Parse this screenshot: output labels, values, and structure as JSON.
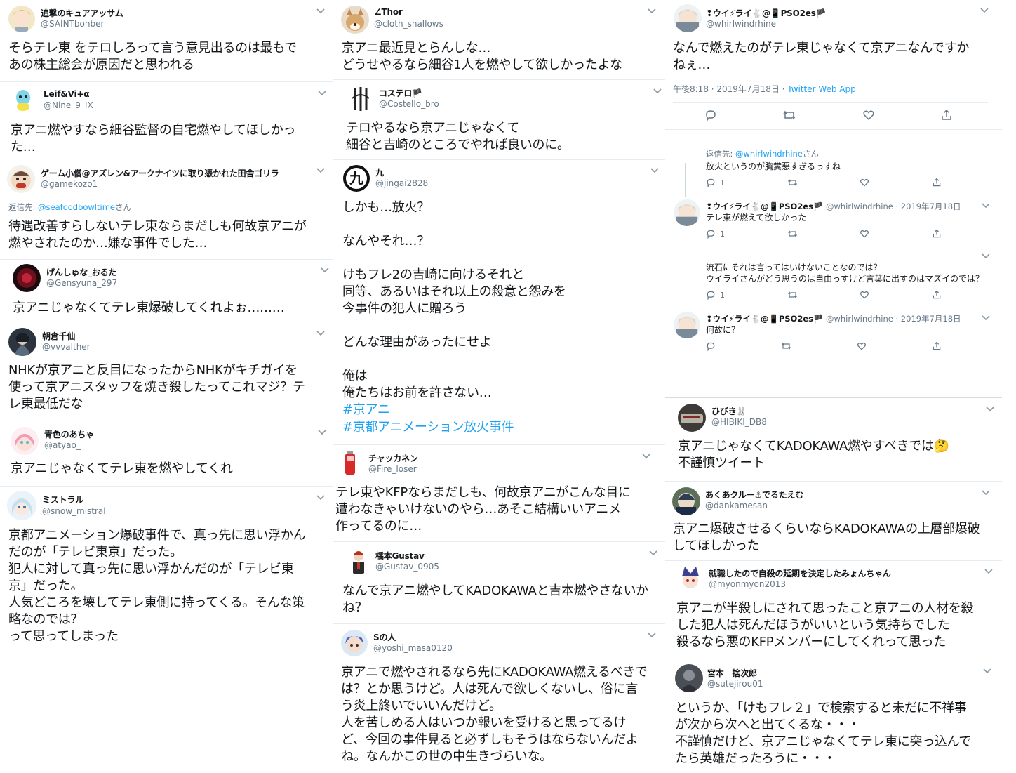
{
  "col1": [
    {
      "name": "追撃のキュアアッサム",
      "handle": "@SAINTbonber",
      "text": "そらテレ東 をテロしろって言う意見出るのは最もで\nあの株主総会が原因だと思われる"
    },
    {
      "name": "Leif&Vi+α",
      "handle": "@Nine_9_IX",
      "text": "京アニ燃やすなら細谷監督の自宅燃やしてほしかっ\nた…"
    },
    {
      "name": "ゲーム小僧@アズレン&アークナイツに取り憑かれた田舎ゴリラ",
      "handle": "@gamekozo1",
      "reply_prefix": "返信先: ",
      "reply_user": "@seafoodbowltime",
      "reply_suffix": "さん",
      "text": "待遇改善すらしないテレ東ならまだしも何故京アニが\n燃やされたのか…嫌な事件でした…"
    },
    {
      "name": "げんしゅな_おるた",
      "handle": "@Gensyuna_297",
      "text": "京アニじゃなくてテレ東爆破してくれよぉ………"
    },
    {
      "name": "朝倉千仙",
      "handle": "@vvvalther",
      "text": "NHKが京アニと反目になったからNHKがキチガイを\n使って京アニスタッフを焼き殺したってこれマジ？テ\nレ東最低だな"
    },
    {
      "name": "青色のあちゃ",
      "handle": "@atyao_",
      "text": "京アニじゃなくてテレ東を燃やしてくれ"
    },
    {
      "name": "ミストラル",
      "handle": "@snow_mistral",
      "text": "京都アニメーション爆破事件で、真っ先に思い浮かん\nだのが「テレビ東京」だった。\n犯人に対して真っ先に思い浮かんだのが「テレビ東\n京」だった。\n人気どころを壊してテレ東側に持ってくる。そんな策\n略なのでは？\nって思ってしまった"
    }
  ],
  "col2": [
    {
      "name": "∠Thor",
      "handle": "@cloth_shallows",
      "text": "京アニ最近見とらんしな…\nどうせやるなら細谷1人を燃やして欲しかったよな"
    },
    {
      "name": "コステロ🏴",
      "handle": "@Costello_bro",
      "text": "テロやるなら京アニじゃなくて\n細谷と吉崎のところでやれば良いのに。"
    },
    {
      "name": "九",
      "handle": "@jingai2828",
      "text": "しかも…放火？\n\nなんやそれ…？\n\nけもフレ2の吉崎に向けるそれと\n同等、あるいはそれ以上の殺意と怨みを\n今事件の犯人に贈ろう\n\nどんな理由があったにせよ\n\n俺は\n俺たちはお前を許さない…",
      "hashtags": [
        "#京アニ",
        "#京都アニメーション放火事件"
      ]
    },
    {
      "name": "チャッカネン",
      "handle": "@Fire_loser",
      "text": "テレ東やKFPならまだしも、何故京アニがこんな目に\n遭わなきゃいけないのやら…あそこ結構いいアニメ\n作ってるのに…"
    },
    {
      "name": "橋本Gustav",
      "handle": "@Gustav_0905",
      "text": "なんで京アニ燃やしてKADOKAWAと吉本燃やさないか\nね？"
    },
    {
      "name": "Sの人",
      "handle": "@yoshi_masa0120",
      "text": "京アニで燃やされるなら先にKADOKAWA燃えるべきで\nは？とか思うけど。人は死んで欲しくないし、俗に言\nう炎上終いでいいんだけど。\n人を苦しめる人はいつか報いを受けると思ってるけ\nど、今回の事件見ると必ずしもそうはならないんだよ\nね。なんかこの世の中生きづらいな。"
    }
  ],
  "col3_main": {
    "name": "❢ウイ⚡ライ🐇@📱PSO2es🏴",
    "handle": "@whirlwindrhine",
    "text": "なんで燃えたのがテレ東じゃなくて京アニなんですか\nねぇ…",
    "time": "午後8:18 · 2019年7月18日 · ",
    "app": "Twitter Web App"
  },
  "col3_replies": [
    {
      "reply_prefix": "返信先: ",
      "reply_user": "@whirlwindrhine",
      "reply_suffix": "さん",
      "text": "放火というのが胸糞悪すぎるっすね",
      "reply_count": "1"
    },
    {
      "name": "❢ウイ⚡ライ🐇@📱PSO2es🏴",
      "handle": "@whirlwindrhine · 2019年7月18日",
      "text": "テレ東が燃えて欲しかった",
      "reply_count": "1"
    },
    {
      "text": "流石にそれは言ってはいけないことなのでは？\nウイライさんがどう思うのは自由っすけど言葉に出すのはマズイのでは？",
      "reply_count": "1"
    },
    {
      "name": "❢ウイ⚡ライ🐇@📱PSO2es🏴",
      "handle": "@whirlwindrhine · 2019年7月18日",
      "text": "何故に？",
      "reply_count": ""
    }
  ],
  "col3": [
    {
      "name": "ひびき🐰",
      "handle": "@HIBIKI_DB8",
      "text": "京アニじゃなくてKADOKAWA燃やすべきでは🤔\n不謹慎ツイート"
    },
    {
      "name": "あくあクルー⚓でるたえむ",
      "handle": "@dankamesan",
      "text": "京アニ爆破させるくらいならKADOKAWAの上層部爆破\nしてほしかった"
    },
    {
      "name": "就職したので自殺の延期を決定したみょんちゃん",
      "handle": "@myonmyon2013",
      "text": "京アニが半殺しにされて思ったこと京アニの人材を殺\nした犯人は死んだほうがいいという気持ちでした\n殺るなら悪のKFPメンバーにしてくれって思った"
    },
    {
      "name": "宮本　捨次郎",
      "handle": "@sutejirou01",
      "text": "というか、「けもフレ２」で検索すると未だに不祥事\nが次から次へと出てくるな・・・\n不謹慎だけど、京アニじゃなくてテレ東に突っ込んで\nたら英雄だったろうに・・・"
    }
  ],
  "colors": {
    "text": "#14171a",
    "secondary": "#657786",
    "link": "#1da1f2",
    "border": "#e6ecf0"
  }
}
